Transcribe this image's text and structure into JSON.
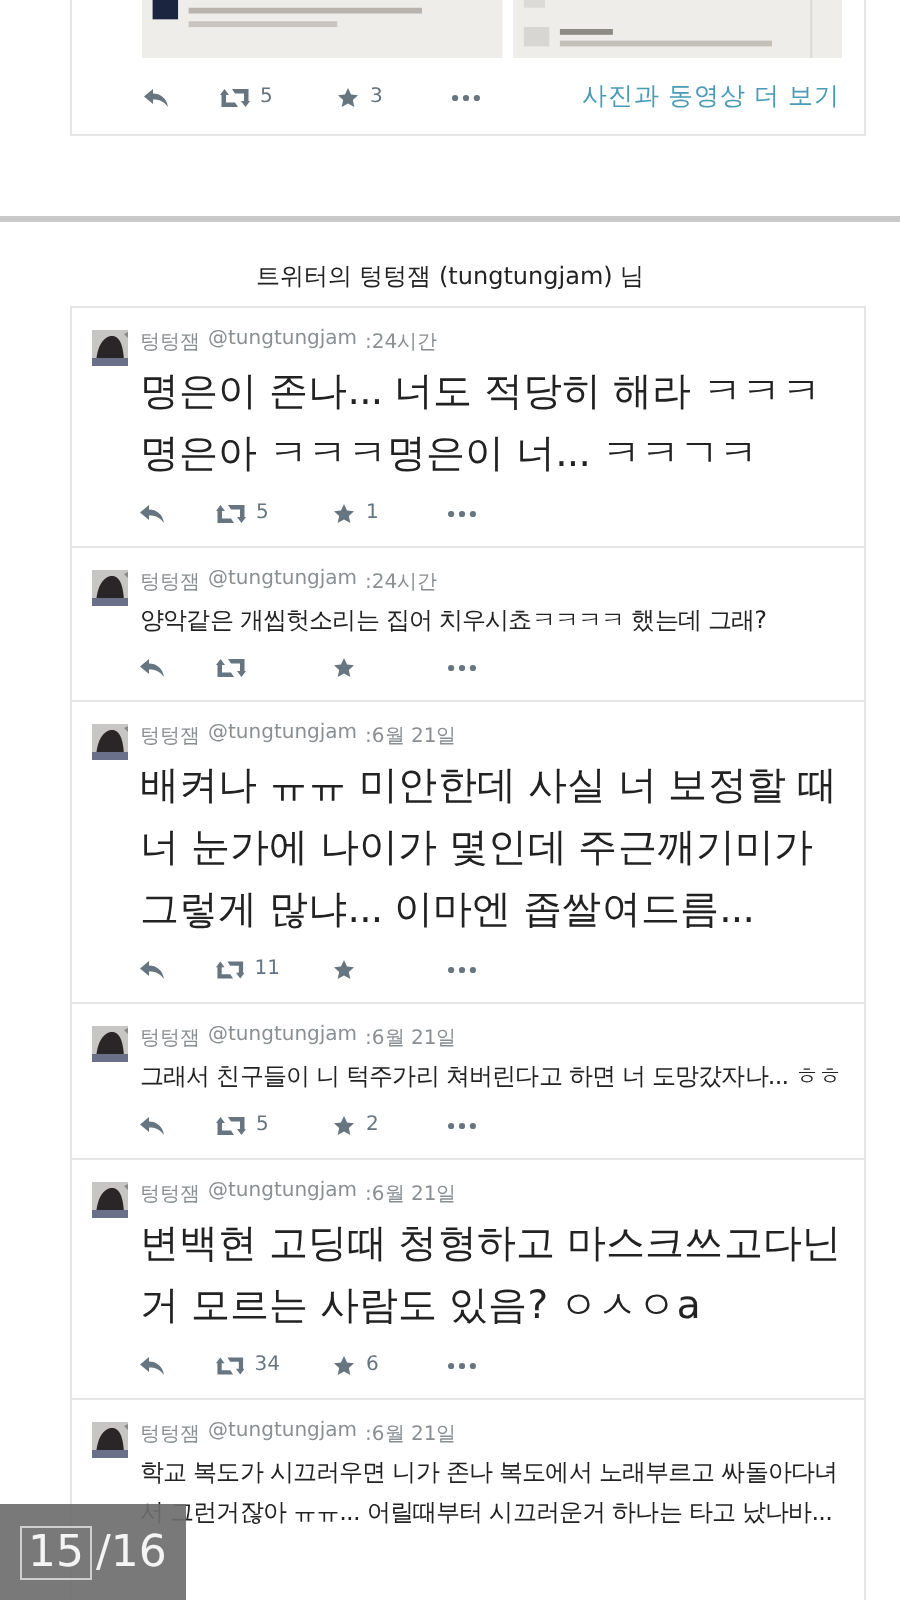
{
  "top_card": {
    "retweets": "5",
    "favorites": "3",
    "more_link": "사진과 동영상 더 보기"
  },
  "header": "트위터의 텅텅잼 (tungtungjam) 님",
  "tweets": [
    {
      "name": "텅텅잼",
      "handle": "@tungtungjam",
      "time": ":24시간",
      "kind": "large",
      "text": "명은이 존나... 너도 적당히 해라 ㅋㅋㅋ 명은아 ㅋㅋㅋ명은이 너... ㅋㅋㄱㅋ",
      "retweets": "5",
      "favorites": "1"
    },
    {
      "name": "텅텅잼",
      "handle": "@tungtungjam",
      "time": ":24시간",
      "kind": "normal",
      "text": "양악같은 개씹헛소리는 집어 치우시쵸ㅋㅋㅋㅋ 했는데 그래?"
    },
    {
      "name": "텅텅잼",
      "handle": "@tungtungjam",
      "time": ":6월 21일",
      "kind": "large",
      "text": "배켜나 ㅠㅠ 미안한데 사실 너 보정할 때 너 눈가에 나이가 몇인데 주근깨기미가 그렇게 많냐... 이마엔 좁쌀여드름...",
      "retweets": "11"
    },
    {
      "name": "텅텅잼",
      "handle": "@tungtungjam",
      "time": ":6월 21일",
      "kind": "normal",
      "text": "그래서 친구들이 니 턱주가리 쳐버린다고 하면 너 도망갔자나... ㅎㅎ",
      "retweets": "5",
      "favorites": "2"
    },
    {
      "name": "텅텅잼",
      "handle": "@tungtungjam",
      "time": ":6월 21일",
      "kind": "large",
      "text": "변백현 고딩때 청형하고 마스크쓰고다닌거 모르는 사람도 있음? ㅇㅅㅇa",
      "retweets": "34",
      "favorites": "6"
    },
    {
      "name": "텅텅잼",
      "handle": "@tungtungjam",
      "time": ":6월 21일",
      "show_actions": false,
      "kind": "normal",
      "text": "학교 복도가 시끄러우면 니가 존나 복도에서 노래부르고 싸돌아다녀서 그런거잖아 ㅠㅠ... 어릴때부터 시끄러운거 하나는 타고 났나바..."
    }
  ],
  "page_counter": {
    "current": "15",
    "total": "/16"
  }
}
